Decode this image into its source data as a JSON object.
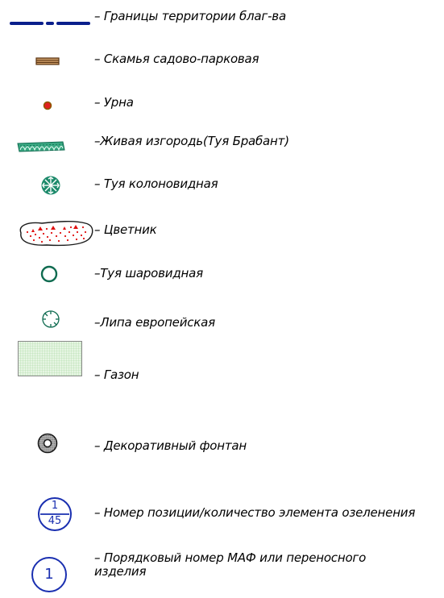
{
  "legend": {
    "items": [
      {
        "key": "boundary",
        "icon": "boundary-line-icon",
        "label": "– Границы территории благ-ва"
      },
      {
        "key": "bench",
        "icon": "bench-icon",
        "label": "– Скамья садово-парковая"
      },
      {
        "key": "urn",
        "icon": "urn-icon",
        "label": "– Урна"
      },
      {
        "key": "hedge",
        "icon": "hedge-icon",
        "label": "–Живая изгородь(Туя Брабант)"
      },
      {
        "key": "thuja_columnar",
        "icon": "thuja-columnar-icon",
        "label": "– Туя колоновидная"
      },
      {
        "key": "flowerbed",
        "icon": "flowerbed-icon",
        "label": "– Цветник"
      },
      {
        "key": "thuja_spherical",
        "icon": "thuja-spherical-icon",
        "label": "–Туя шаровидная"
      },
      {
        "key": "linden",
        "icon": "linden-icon",
        "label": "–Липа европейская"
      },
      {
        "key": "lawn",
        "icon": "lawn-icon",
        "label": "– Газон"
      },
      {
        "key": "fountain",
        "icon": "fountain-icon",
        "label": "– Декоративный фонтан"
      },
      {
        "key": "position_number",
        "icon": "position-number-icon",
        "label": "– Номер позиции/количество элемента озеленения"
      },
      {
        "key": "maf_number",
        "icon": "maf-number-icon",
        "label": "– Порядковый номер МАФ или переносного изделия"
      }
    ],
    "position_badge": {
      "top": "1",
      "bottom": "45"
    },
    "maf_badge": {
      "number": "1"
    }
  },
  "colors": {
    "boundary": "#0a1f8c",
    "bench_wood": "#7a4a1e",
    "urn_fill": "#e02020",
    "urn_ring": "#8a5a00",
    "green": "#1d8a6b",
    "flower_red": "#e01010",
    "lawn_fill": "#e6f5e3",
    "lawn_grid": "#a8d8a0",
    "fountain_gray": "#9a9a9a",
    "badge_blue": "#1a2fb0"
  }
}
